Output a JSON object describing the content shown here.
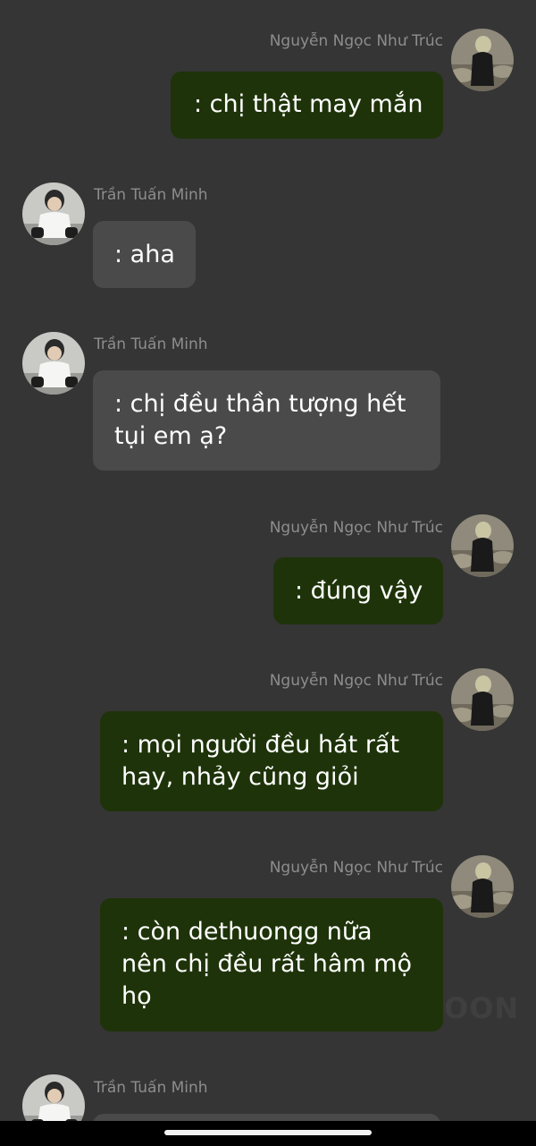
{
  "chat": {
    "participants": {
      "right": "Nguyễn Ngọc Như Trúc",
      "left": "Trần Tuấn Minh"
    },
    "messages": [
      {
        "sender": "Nguyễn Ngọc Như Trúc",
        "side": "right",
        "lines": [
          ": chị thật may mắn"
        ]
      },
      {
        "sender": "Trần Tuấn Minh",
        "side": "left",
        "lines": [
          ": aha"
        ]
      },
      {
        "sender": "Trần Tuấn Minh",
        "side": "left",
        "lines": [
          ": chị đều thần tượng hết",
          "tụi em ạ?"
        ]
      },
      {
        "sender": "Nguyễn Ngọc Như Trúc",
        "side": "right",
        "lines": [
          ": đúng vậy"
        ]
      },
      {
        "sender": "Nguyễn Ngọc Như Trúc",
        "side": "right",
        "lines": [
          ": mọi người đều hát rất",
          "hay, nhảy cũng giỏi"
        ]
      },
      {
        "sender": "Nguyễn Ngọc Như Trúc",
        "side": "right",
        "lines": [
          ": còn dethuongg nữa",
          "nên chị đều rất hâm mộ",
          "họ"
        ]
      },
      {
        "sender": "Trần Tuấn Minh",
        "side": "left",
        "lines": []
      }
    ]
  },
  "watermark": "OON",
  "colors": {
    "background": "#353535",
    "outgoing_bubble": "#1e3309",
    "incoming_bubble": "#4a4a4a",
    "name_text": "#8d8d8d",
    "message_text": "#ffffff"
  },
  "icons": {
    "right_avatar": "profile-photo-girl-icon",
    "left_avatar": "profile-photo-boy-icon"
  }
}
